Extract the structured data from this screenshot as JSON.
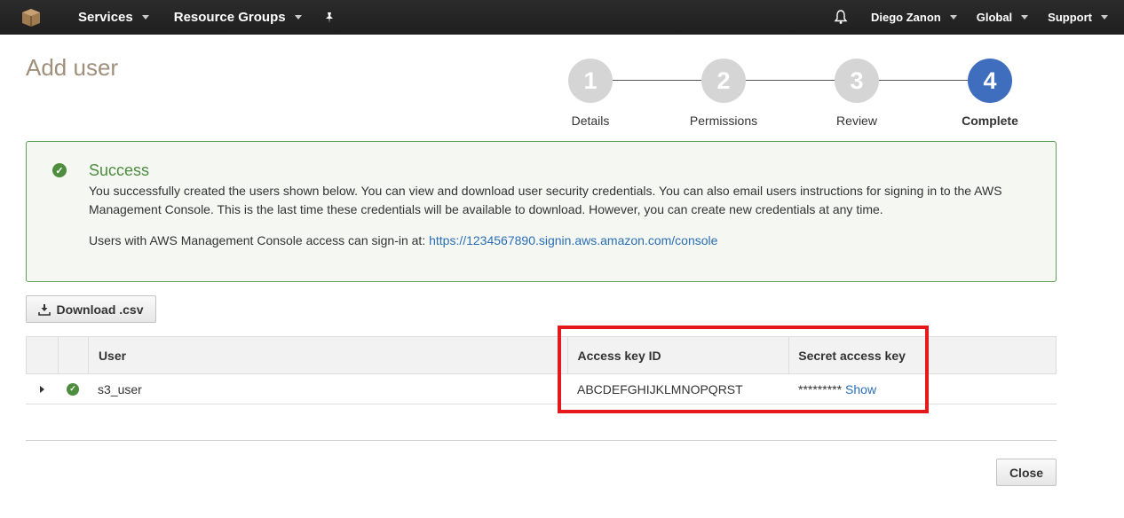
{
  "nav": {
    "services": "Services",
    "resource_groups": "Resource Groups",
    "user": "Diego Zanon",
    "region": "Global",
    "support": "Support"
  },
  "page_title": "Add user",
  "steps": [
    {
      "number": "1",
      "label": "Details"
    },
    {
      "number": "2",
      "label": "Permissions"
    },
    {
      "number": "3",
      "label": "Review"
    },
    {
      "number": "4",
      "label": "Complete"
    }
  ],
  "success": {
    "heading": "Success",
    "message": "You successfully created the users shown below. You can view and download user security credentials. You can also email users instructions for signing in to the AWS Management Console. This is the last time these credentials will be available to download. However, you can create new credentials at any time.",
    "signin_prefix": "Users with AWS Management Console access can sign-in at:",
    "signin_url": "https://1234567890.signin.aws.amazon.com/console"
  },
  "download_button": "Download .csv",
  "table": {
    "headers": {
      "user": "User",
      "access_key_id": "Access key ID",
      "secret_access_key": "Secret access key"
    },
    "rows": [
      {
        "user": "s3_user",
        "access_key_id": "ABCDEFGHIJKLMNOPQRST",
        "secret_masked": "*********",
        "show_label": "Show"
      }
    ]
  },
  "close_button": "Close",
  "colors": {
    "active_step": "#3e6ebd",
    "success_green": "#4e8c3e",
    "highlight_red": "#e3191b"
  }
}
